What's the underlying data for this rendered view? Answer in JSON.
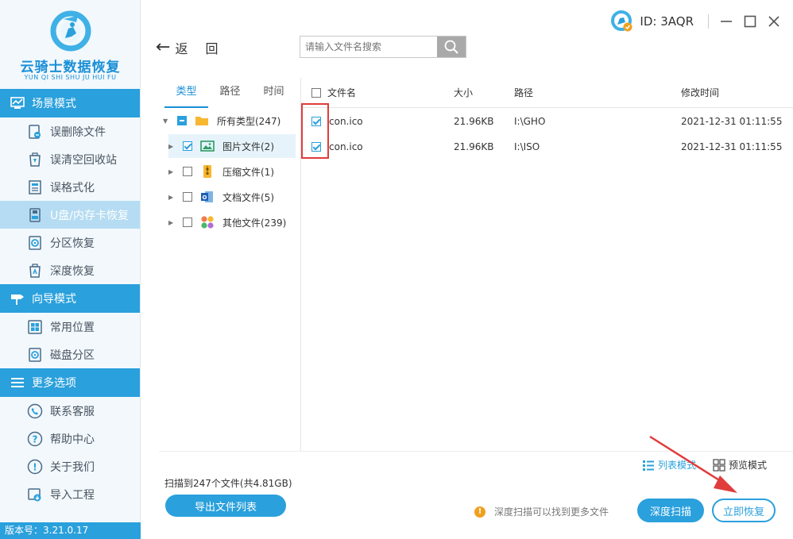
{
  "app": {
    "title_cn": "云骑士数据恢复",
    "title_pinyin": "YUN QI SHI SHU JU HUI FU",
    "version": "版本号：3.21.0.17",
    "accent": "#2aa0dc"
  },
  "header": {
    "back_label": "返回",
    "search_placeholder": "请输入文件名搜索",
    "user_id": "ID: 3AQR",
    "window_controls": [
      "minimize-icon",
      "maximize-icon",
      "close-icon"
    ]
  },
  "sidebar": {
    "sections": [
      {
        "title": "场景模式",
        "icon": "scene-mode-icon",
        "items": [
          {
            "label": "误删除文件",
            "icon": "delete-file-icon"
          },
          {
            "label": "误清空回收站",
            "icon": "recycle-bin-icon"
          },
          {
            "label": "误格式化",
            "icon": "format-icon"
          },
          {
            "label": "U盘/内存卡恢复",
            "icon": "usb-drive-icon",
            "active": true
          },
          {
            "label": "分区恢复",
            "icon": "partition-icon"
          },
          {
            "label": "深度恢复",
            "icon": "deep-recover-icon"
          }
        ]
      },
      {
        "title": "向导模式",
        "icon": "guide-mode-icon",
        "items": [
          {
            "label": "常用位置",
            "icon": "windows-icon"
          },
          {
            "label": "磁盘分区",
            "icon": "disk-icon"
          }
        ]
      },
      {
        "title": "更多选项",
        "icon": "menu-icon",
        "items": [
          {
            "label": "联系客服",
            "icon": "phone-icon"
          },
          {
            "label": "帮助中心",
            "icon": "help-icon"
          },
          {
            "label": "关于我们",
            "icon": "info-icon"
          },
          {
            "label": "导入工程",
            "icon": "import-icon"
          }
        ]
      }
    ]
  },
  "filter": {
    "tabs": [
      "类型",
      "路径",
      "时间"
    ],
    "active_tab": 0,
    "tree": [
      {
        "label": "所有类型(247)",
        "state": "partial",
        "expanded": true,
        "icon": "folder-icon"
      },
      {
        "label": "图片文件(2)",
        "state": "checked",
        "selected": true,
        "icon": "image-icon"
      },
      {
        "label": "压缩文件(1)",
        "state": "unchecked",
        "icon": "zip-icon"
      },
      {
        "label": "文档文件(5)",
        "state": "unchecked",
        "icon": "document-icon"
      },
      {
        "label": "其他文件(239)",
        "state": "unchecked",
        "icon": "other-files-icon"
      }
    ]
  },
  "file_list": {
    "columns": [
      "文件名",
      "大小",
      "路径",
      "修改时间"
    ],
    "rows": [
      {
        "name": "con.ico",
        "size": "21.96KB",
        "path": "I:\\GHO",
        "mtime": "2021-12-31 01:11:55",
        "checked": true
      },
      {
        "name": "con.ico",
        "size": "21.96KB",
        "path": "I:\\ISO",
        "mtime": "2021-12-31 01:11:55",
        "checked": true
      }
    ]
  },
  "footer": {
    "scan_summary": "扫描到247个文件(共4.81GB)",
    "export_button": "导出文件列表",
    "list_mode": "列表模式",
    "preview_mode": "预览模式",
    "tip": "深度扫描可以找到更多文件",
    "deep_scan_button": "深度扫描",
    "recover_button": "立即恢复"
  }
}
